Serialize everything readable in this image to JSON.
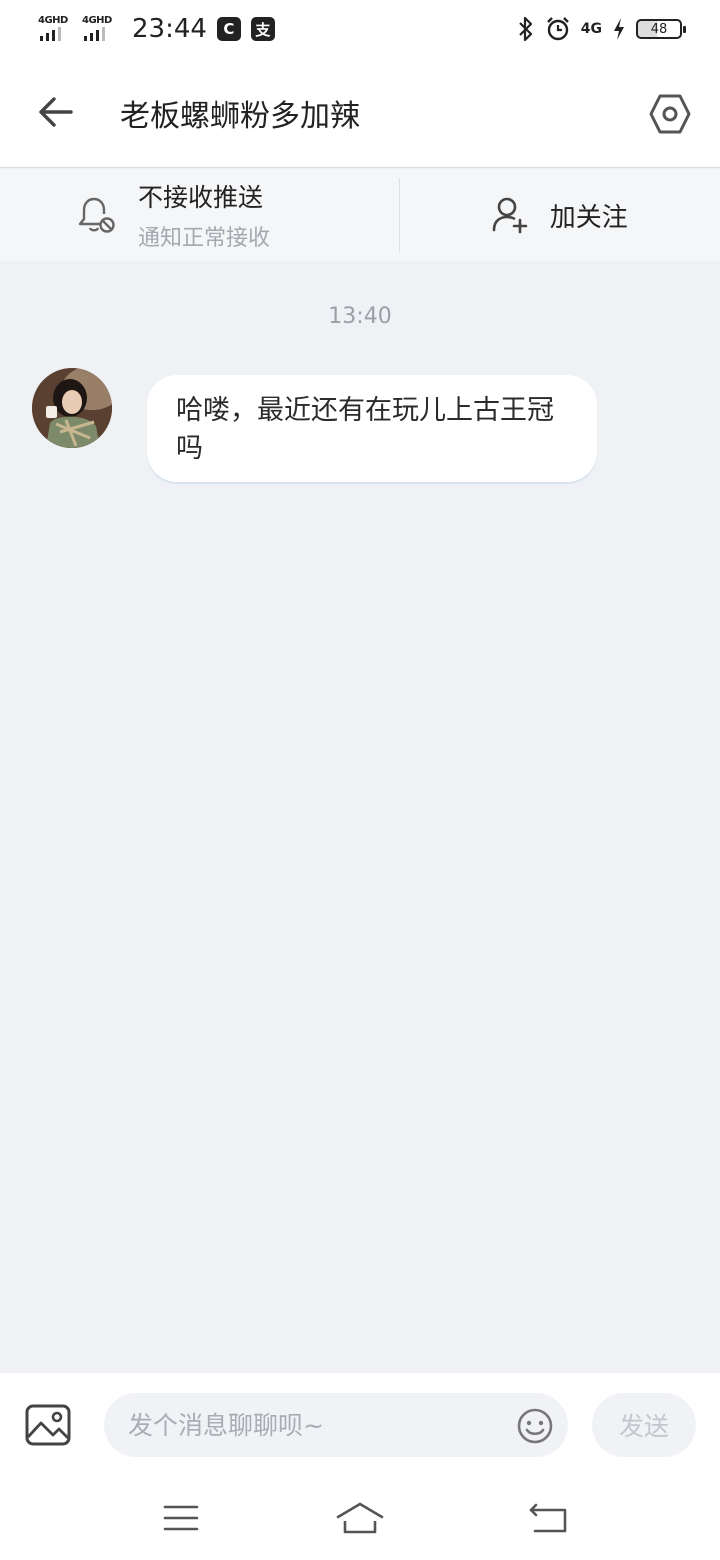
{
  "status_bar": {
    "signal1_label": "4GHD",
    "signal2_label": "4GHD",
    "time": "23:44",
    "app_icon_1": "C",
    "app_icon_2": "支",
    "network_label": "4G",
    "battery_level": "48",
    "icons": [
      "bluetooth-icon",
      "alarm-icon",
      "charging-icon"
    ]
  },
  "header": {
    "title": "老板螺蛳粉多加辣",
    "back_icon": "arrow-left-icon",
    "settings_icon": "hexagon-settings-icon"
  },
  "actions": {
    "push": {
      "title": "不接收推送",
      "subtitle": "通知正常接收",
      "icon": "bell-muted-icon"
    },
    "follow": {
      "label": "加关注",
      "icon": "user-add-icon"
    }
  },
  "messages": [
    {
      "time": "13:40",
      "text": "哈喽，最近还有在玩儿上古王冠吗",
      "from": "other"
    }
  ],
  "input": {
    "placeholder": "发个消息聊聊呗~",
    "value": "",
    "send_label": "发送",
    "image_icon": "image-icon",
    "emoji_icon": "emoji-icon"
  },
  "nav": [
    "menu-icon",
    "home-icon",
    "back-nav-icon"
  ],
  "colors": {
    "background": "#eff1f4",
    "bubble": "#ffffff",
    "muted_text": "#a4a8b0"
  }
}
